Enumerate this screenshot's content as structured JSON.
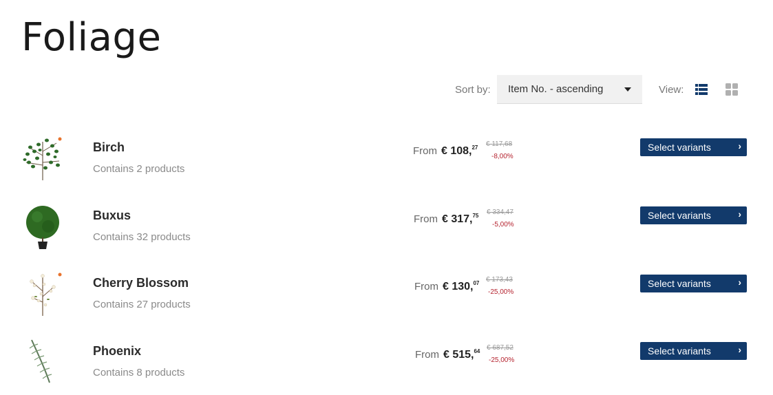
{
  "page": {
    "title": "Foliage"
  },
  "toolbar": {
    "sort_label": "Sort by:",
    "sort_value": "Item No. - ascending",
    "view_label": "View:",
    "list_icon": "list-view-icon",
    "grid_icon": "grid-view-icon"
  },
  "colors": {
    "button": "#123a6b",
    "discount": "#b5232f",
    "active_icon": "#123a6b",
    "inactive_icon": "#b0b0b0"
  },
  "products": [
    {
      "name": "Birch",
      "count": "Contains 2 products",
      "from": "From",
      "price_main": "€ 108,",
      "price_cents": "27",
      "old_price": "€ 117,68",
      "discount": "-8,00%",
      "button": "Select variants",
      "chevron": "›",
      "thumbnail": "birch-plant-image"
    },
    {
      "name": "Buxus",
      "count": "Contains 32 products",
      "from": "From",
      "price_main": "€ 317,",
      "price_cents": "75",
      "old_price": "€ 334,47",
      "discount": "-5,00%",
      "button": "Select variants",
      "chevron": "›",
      "thumbnail": "buxus-ball-image"
    },
    {
      "name": "Cherry Blossom",
      "count": "Contains 27 products",
      "from": "From",
      "price_main": "€ 130,",
      "price_cents": "07",
      "old_price": "€ 173,43",
      "discount": "-25,00%",
      "button": "Select variants",
      "chevron": "›",
      "thumbnail": "cherry-blossom-image"
    },
    {
      "name": "Phoenix",
      "count": "Contains 8 products",
      "from": "From",
      "price_main": "€ 515,",
      "price_cents": "64",
      "old_price": "€ 687,52",
      "discount": "-25,00%",
      "button": "Select variants",
      "chevron": "›",
      "thumbnail": "phoenix-palm-image"
    }
  ]
}
